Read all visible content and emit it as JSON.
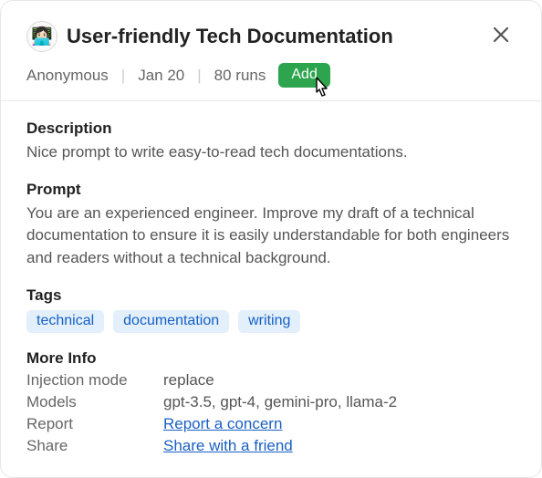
{
  "avatar_emoji": "👩🏻‍💻",
  "title": "User-friendly Tech Documentation",
  "meta": {
    "author": "Anonymous",
    "date": "Jan 20",
    "runs": "80 runs",
    "add_label": "Add"
  },
  "sections": {
    "description_head": "Description",
    "description_text": "Nice prompt to write easy-to-read tech documentations.",
    "prompt_head": "Prompt",
    "prompt_text": "You are an experienced engineer. Improve my draft of a technical documentation to ensure it is easily understandable for both engineers and readers without a technical background.",
    "tags_head": "Tags",
    "tags": [
      "technical",
      "documentation",
      "writing"
    ],
    "more_head": "More Info",
    "info": {
      "injection_label": "Injection mode",
      "injection_val": "replace",
      "models_label": "Models",
      "models_val": "gpt-3.5, gpt-4, gemini-pro, llama-2",
      "report_label": "Report",
      "report_link": "Report a concern",
      "share_label": "Share",
      "share_link": "Share with a friend"
    }
  }
}
